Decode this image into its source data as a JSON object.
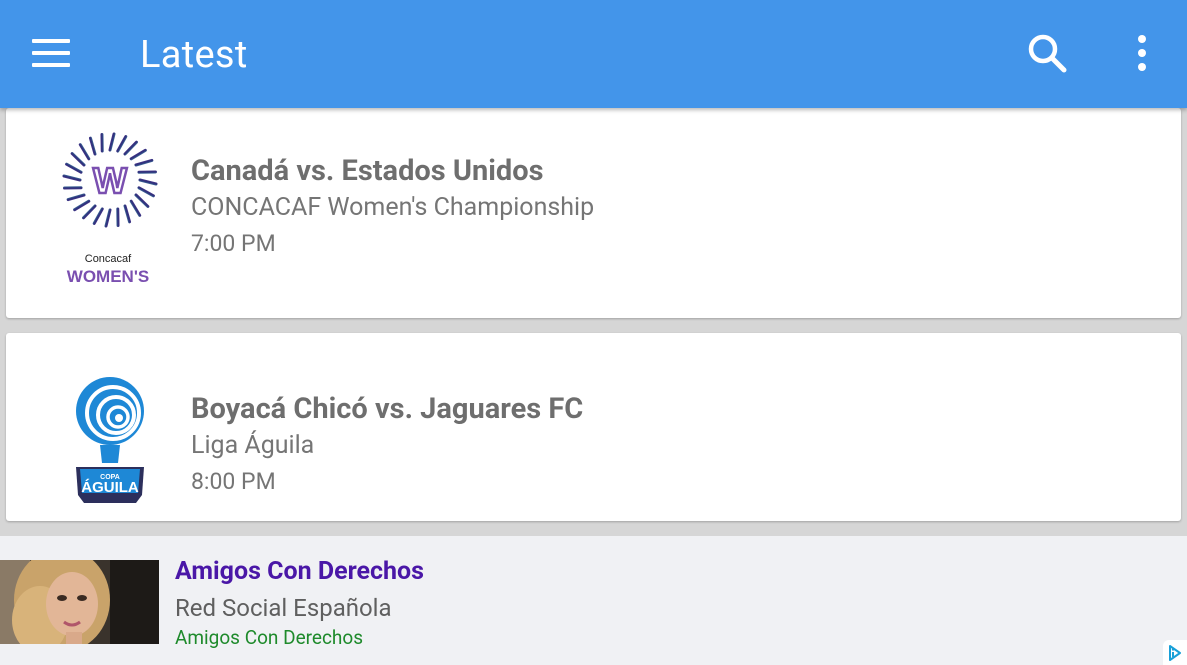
{
  "appbar": {
    "title": "Latest",
    "color": "#4395ea",
    "menu_icon": "hamburger-menu-icon",
    "search_icon": "search-icon",
    "overflow_icon": "more-vertical-icon"
  },
  "matches": [
    {
      "title": "Canadá vs. Estados Unidos",
      "league": "CONCACAF Women's Championship",
      "time": "7:00 PM",
      "logo": {
        "icon": "concacaf-womens-logo",
        "line1": "Concacaf",
        "line2": "WOMEN'S"
      }
    },
    {
      "title": "Boyacá Chicó vs. Jaguares FC",
      "league": "Liga Águila",
      "time": "8:00 PM",
      "logo": {
        "icon": "copa-aguila-logo",
        "line1": "COPA",
        "line2": "ÁGUILA"
      }
    }
  ],
  "ad": {
    "title": "Amigos Con Derechos",
    "subtitle": "Red Social Española",
    "url": "Amigos Con Derechos",
    "image_icon": "ad-photo",
    "choices_icon": "adchoices-icon",
    "colors": {
      "title": "#4a17a7",
      "url": "#1e8a2b"
    }
  }
}
